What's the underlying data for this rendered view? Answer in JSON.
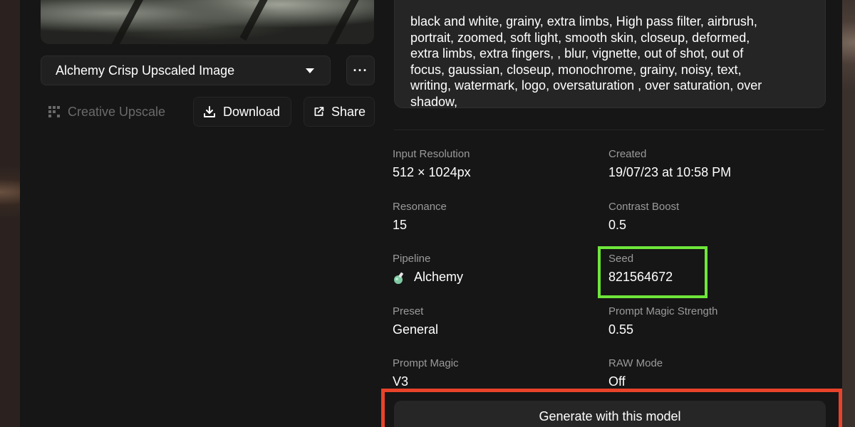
{
  "image_select": {
    "label": "Alchemy Crisp Upscaled Image"
  },
  "more_button": {
    "label": "···"
  },
  "actions": {
    "creative_upscale": "Creative Upscale",
    "download": "Download",
    "share": "Share"
  },
  "prompt": {
    "text": "black and white, grainy, extra limbs, High pass filter, airbrush,\nportrait, zoomed, soft light, smooth skin, closeup, deformed,\nextra limbs, extra fingers, , blur, vignette, out of shot, out of\nfocus, gaussian, closeup, monochrome, grainy, noisy, text,\nwriting, watermark, logo, oversaturation , over saturation, over\nshadow,"
  },
  "details": {
    "input_resolution": {
      "label": "Input Resolution",
      "value": "512 × 1024px"
    },
    "created": {
      "label": "Created",
      "value": "19/07/23 at 10:58 PM"
    },
    "resonance": {
      "label": "Resonance",
      "value": "15"
    },
    "contrast_boost": {
      "label": "Contrast Boost",
      "value": "0.5"
    },
    "pipeline": {
      "label": "Pipeline",
      "value": "Alchemy"
    },
    "seed": {
      "label": "Seed",
      "value": "821564672"
    },
    "preset": {
      "label": "Preset",
      "value": "General"
    },
    "prompt_magic_strength": {
      "label": "Prompt Magic Strength",
      "value": "0.55"
    },
    "prompt_magic": {
      "label": "Prompt Magic",
      "value": "V3"
    },
    "raw_mode": {
      "label": "RAW Mode",
      "value": "Off"
    }
  },
  "generate_button": {
    "label": "Generate with this model"
  },
  "colors": {
    "seed_highlight": "#6ee63a",
    "generate_highlight": "#e8432a"
  }
}
